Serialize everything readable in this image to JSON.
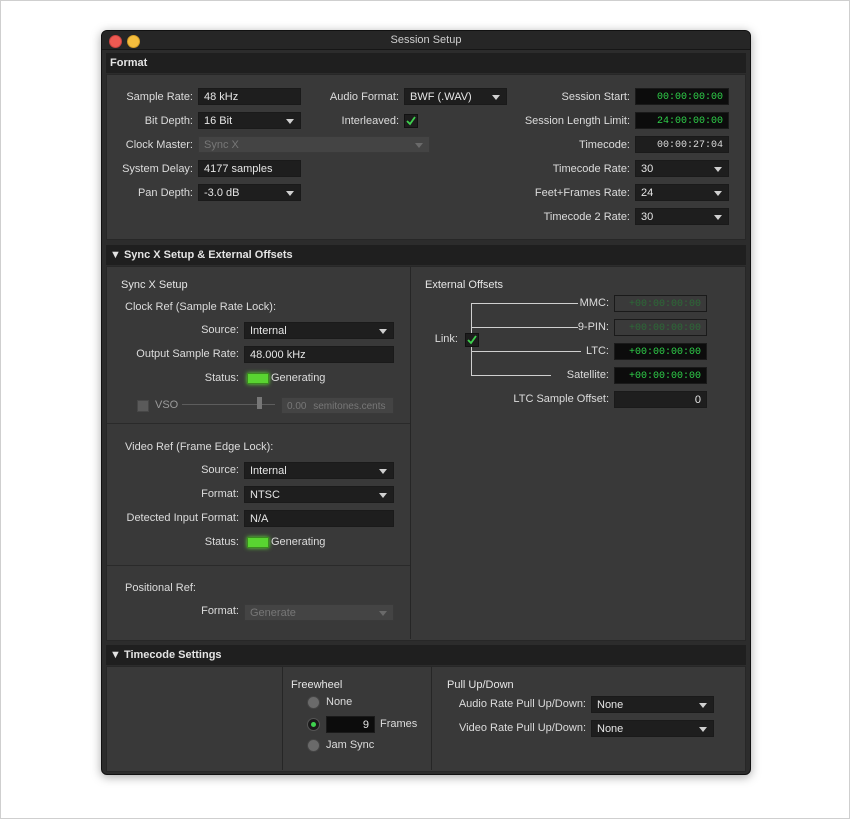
{
  "window": {
    "title": "Session Setup"
  },
  "format": {
    "header": "Format",
    "sample_rate": {
      "label": "Sample Rate:",
      "value": "48 kHz"
    },
    "bit_depth": {
      "label": "Bit Depth:",
      "value": "16 Bit"
    },
    "clock_master": {
      "label": "Clock Master:",
      "value": "Sync X"
    },
    "system_delay": {
      "label": "System Delay:",
      "value": "4177 samples"
    },
    "pan_depth": {
      "label": "Pan Depth:",
      "value": "-3.0 dB"
    },
    "audio_format": {
      "label": "Audio Format:",
      "value": "BWF (.WAV)"
    },
    "interleaved": {
      "label": "Interleaved:",
      "checked": true
    },
    "session_start": {
      "label": "Session Start:",
      "value": "00:00:00:00"
    },
    "session_length_limit": {
      "label": "Session Length Limit:",
      "value": "24:00:00:00"
    },
    "timecode": {
      "label": "Timecode:",
      "value": "00:00:27:04"
    },
    "timecode_rate": {
      "label": "Timecode Rate:",
      "value": "30"
    },
    "feet_frames_rate": {
      "label": "Feet+Frames Rate:",
      "value": "24"
    },
    "timecode2_rate": {
      "label": "Timecode 2 Rate:",
      "value": "30"
    }
  },
  "sync": {
    "header": "▼ Sync X Setup & External Offsets",
    "setup_title": "Sync X Setup",
    "clock_ref": {
      "title": "Clock Ref (Sample Rate Lock):",
      "source": {
        "label": "Source:",
        "value": "Internal"
      },
      "output_sample_rate": {
        "label": "Output Sample Rate:",
        "value": "48.000 kHz"
      },
      "status": {
        "label": "Status:",
        "value": "Generating"
      },
      "vso": {
        "label": "VSO",
        "value": "0.00",
        "unit": "semitones.cents"
      }
    },
    "video_ref": {
      "title": "Video Ref (Frame Edge Lock):",
      "source": {
        "label": "Source:",
        "value": "Internal"
      },
      "format": {
        "label": "Format:",
        "value": "NTSC"
      },
      "detected": {
        "label": "Detected Input Format:",
        "value": "N/A"
      },
      "status": {
        "label": "Status:",
        "value": "Generating"
      }
    },
    "positional_ref": {
      "title": "Positional Ref:",
      "format": {
        "label": "Format:",
        "value": "Generate"
      }
    },
    "external_offsets": {
      "title": "External Offsets",
      "link_label": "Link:",
      "mmc": {
        "label": "MMC:",
        "value": "+00:00:00:00"
      },
      "nine_pin": {
        "label": "9-PIN:",
        "value": "+00:00:00:00"
      },
      "ltc": {
        "label": "LTC:",
        "value": "+00:00:00:00"
      },
      "satellite": {
        "label": "Satellite:",
        "value": "+00:00:00:00"
      },
      "ltc_sample_offset": {
        "label": "LTC Sample Offset:",
        "value": "0"
      }
    }
  },
  "timecode_settings": {
    "header": "▼ Timecode Settings",
    "freewheel": {
      "title": "Freewheel",
      "none_label": "None",
      "frames_value": "9",
      "frames_label": "Frames",
      "jam_sync_label": "Jam Sync"
    },
    "pull": {
      "title": "Pull Up/Down",
      "audio": {
        "label": "Audio Rate Pull Up/Down:",
        "value": "None"
      },
      "video": {
        "label": "Video Rate Pull Up/Down:",
        "value": "None"
      }
    }
  },
  "colors": {
    "timecode_green": "#2fd24a",
    "led_green": "#59d431",
    "panel": "#393939",
    "background": "#2c2c2c"
  }
}
